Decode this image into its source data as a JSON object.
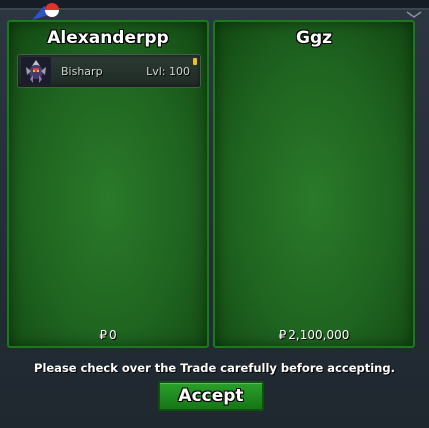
{
  "left_player": {
    "name": "Alexanderpp",
    "money": "0",
    "items": [
      {
        "name": "Bisharp",
        "level": "Lvl: 100",
        "icon": "bisharp-sprite-icon"
      }
    ]
  },
  "right_player": {
    "name": "Ggz",
    "money": "2,100,000",
    "items": []
  },
  "currency_symbol": "₽",
  "notice": "Please check over the Trade carefully before accepting.",
  "accept_label": "Accept",
  "colors": {
    "panel_green": "#1f6420",
    "panel_border": "#1a7a1a",
    "button_green": "#2aa02a",
    "background": "#232b35",
    "item_marker": "#f0c020"
  }
}
